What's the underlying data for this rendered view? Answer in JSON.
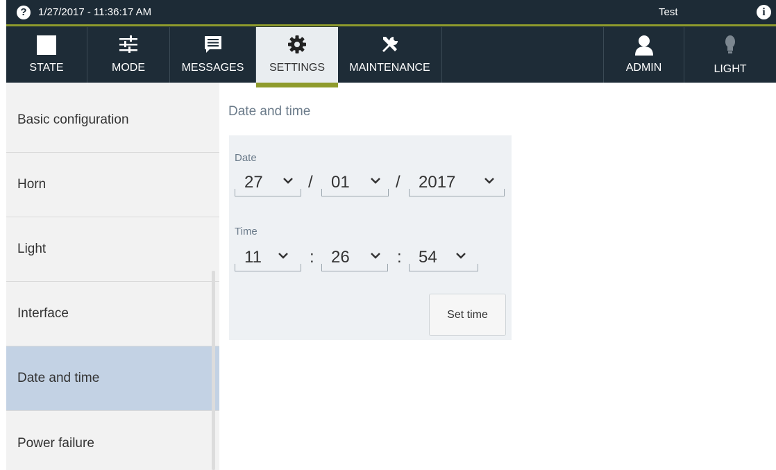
{
  "status_bar": {
    "help_icon_glyph": "?",
    "datetime": "1/27/2017 - 11:36:17 AM",
    "user": "Test",
    "info_icon_glyph": "i"
  },
  "nav": {
    "tabs": [
      {
        "id": "state",
        "label": "STATE",
        "icon": "stop-square-icon"
      },
      {
        "id": "mode",
        "label": "MODE",
        "icon": "sliders-icon"
      },
      {
        "id": "messages",
        "label": "MESSAGES",
        "icon": "message-list-icon"
      },
      {
        "id": "settings",
        "label": "SETTINGS",
        "icon": "gear-icon",
        "active": true
      },
      {
        "id": "maintenance",
        "label": "MAINTENANCE",
        "icon": "wrench-screwdriver-icon"
      }
    ],
    "right_tabs": [
      {
        "id": "admin",
        "label": "ADMIN",
        "icon": "user-icon"
      },
      {
        "id": "light",
        "label": "LIGHT",
        "icon": "lightbulb-icon"
      }
    ]
  },
  "sidebar": {
    "items": [
      {
        "label": "Basic configuration"
      },
      {
        "label": "Horn"
      },
      {
        "label": "Light"
      },
      {
        "label": "Interface"
      },
      {
        "label": "Date and time",
        "active": true
      },
      {
        "label": "Power failure"
      }
    ]
  },
  "main": {
    "title": "Date and time",
    "date_label": "Date",
    "date": {
      "day": "27",
      "month": "01",
      "year": "2017",
      "separator": "/"
    },
    "time_label": "Time",
    "time": {
      "hour": "11",
      "minute": "26",
      "second": "54",
      "separator": ":"
    },
    "set_button_label": "Set time"
  },
  "colors": {
    "bar_bg": "#1d2b36",
    "accent": "#8f9b2c",
    "active_sidebar": "#c3d2e4",
    "panel_bg": "#eef1f4"
  }
}
